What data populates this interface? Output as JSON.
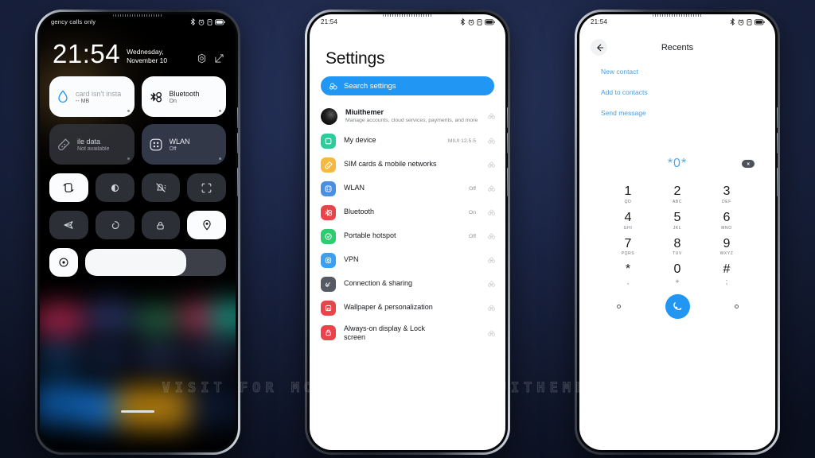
{
  "watermark": "VISIT FOR MORE THEMES - MIUITHEMER.COM",
  "theme": {
    "accent": "#2196f3",
    "link": "#4a9fe0",
    "background": "#1d2748"
  },
  "phone1": {
    "name": "lock-screen-control-center",
    "statusbar": {
      "carrier": "gency calls only",
      "time": ""
    },
    "clock": {
      "time": "21:54",
      "weekday": "Wednesday,",
      "date": "November 10"
    },
    "tiles": [
      {
        "title": "card isn't insta",
        "sub": "-- MB",
        "icon": "data-usage-icon",
        "state": "light"
      },
      {
        "title": "Bluetooth",
        "sub": "On",
        "icon": "bluetooth-icon",
        "state": "light"
      },
      {
        "title": "ile data",
        "sub": "Not available",
        "icon": "mobile-data-icon",
        "state": "dark"
      },
      {
        "title": "WLAN",
        "sub": "Off",
        "icon": "wlan-icon",
        "state": "dark2"
      }
    ],
    "toggles": [
      {
        "name": "auto-rotate-toggle",
        "state": "on"
      },
      {
        "name": "dark-mode-toggle",
        "state": "off"
      },
      {
        "name": "silent-toggle",
        "state": "off"
      },
      {
        "name": "screenshot-toggle",
        "state": "off"
      },
      {
        "name": "airplane-mode-toggle",
        "state": "off"
      },
      {
        "name": "nfc-toggle",
        "state": "off"
      },
      {
        "name": "lock-toggle",
        "state": "off"
      },
      {
        "name": "location-toggle",
        "state": "on"
      }
    ],
    "brightness": {
      "name": "brightness-slider",
      "value": 72
    }
  },
  "phone2": {
    "name": "settings-app",
    "statusbar": {
      "time": "21:54"
    },
    "title": "Settings",
    "search": {
      "placeholder": "Search settings",
      "icon": "search-icon"
    },
    "account": {
      "label": "Miuithemer",
      "desc": "Manage accounts, cloud services, payments, and more"
    },
    "items": [
      {
        "label": "My device",
        "value": "MIUI 12.5.5",
        "icon": "device-icon",
        "color": "#2ecc9b"
      },
      {
        "label": "SIM cards & mobile networks",
        "value": "",
        "icon": "sim-icon",
        "color": "#f5b942"
      },
      {
        "label": "WLAN",
        "value": "Off",
        "icon": "wlan-icon",
        "color": "#4a90e2"
      },
      {
        "label": "Bluetooth",
        "value": "On",
        "icon": "bluetooth-icon",
        "color": "#e8454b"
      },
      {
        "label": "Portable hotspot",
        "value": "Off",
        "icon": "hotspot-icon",
        "color": "#2ecc71"
      },
      {
        "label": "VPN",
        "value": "",
        "icon": "vpn-icon",
        "color": "#3aa0f3"
      },
      {
        "label": "Connection & sharing",
        "value": "",
        "icon": "sharing-icon",
        "color": "#565b63"
      },
      {
        "label": "Wallpaper & personalization",
        "value": "",
        "icon": "wallpaper-icon",
        "color": "#e8454b"
      },
      {
        "label": "Always-on display & Lock screen",
        "value": "",
        "icon": "lock-icon",
        "color": "#e8454b"
      }
    ]
  },
  "phone3": {
    "name": "dialer-app",
    "statusbar": {
      "time": "21:54"
    },
    "appbar": {
      "back": "back-arrow-icon",
      "title": "Recents"
    },
    "links": [
      "New contact",
      "Add to contacts",
      "Send message"
    ],
    "number": "*0*",
    "delete": "backspace-icon",
    "keys": [
      {
        "digit": "1",
        "letters": "QD"
      },
      {
        "digit": "2",
        "letters": "ABC"
      },
      {
        "digit": "3",
        "letters": "DEF"
      },
      {
        "digit": "4",
        "letters": "GHI"
      },
      {
        "digit": "5",
        "letters": "JKL"
      },
      {
        "digit": "6",
        "letters": "MNO"
      },
      {
        "digit": "7",
        "letters": "PQRS"
      },
      {
        "digit": "8",
        "letters": "TUV"
      },
      {
        "digit": "9",
        "letters": "WXYZ"
      },
      {
        "digit": "*",
        "letters": ","
      },
      {
        "digit": "0",
        "letters": "+"
      },
      {
        "digit": "#",
        "letters": ";"
      }
    ],
    "call_button": "call-icon"
  }
}
